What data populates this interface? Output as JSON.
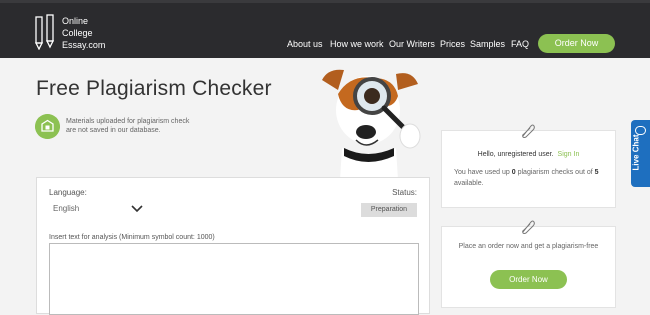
{
  "header": {
    "logo_lines": [
      "Online",
      "College",
      "Essay.com"
    ],
    "nav": [
      "About us",
      "How we work",
      "Our Writers",
      "Prices",
      "Samples",
      "FAQ"
    ],
    "order_button": "Order Now"
  },
  "hero": {
    "title": "Free Plagiarism Checker",
    "note": "Materials uploaded for plagiarism check are not saved in our database."
  },
  "checker": {
    "language_label": "Language:",
    "language_value": "English",
    "status_label": "Status:",
    "status_value": "Preparation",
    "textarea_label": "Insert text for analysis (Minimum symbol count: 1000)"
  },
  "user_card": {
    "hello": "Hello, unregistered user.",
    "sign_in": "Sign In",
    "usage_prefix": "You have used up",
    "used_count": "0",
    "usage_middle": "plagiarism checks out of",
    "total_count": "5",
    "usage_suffix": "available."
  },
  "order_card": {
    "message": "Place an order now and get a plagiarism-free",
    "button": "Order Now"
  },
  "live_chat": {
    "label": "Live Chat"
  },
  "colors": {
    "header_bg": "#2b2b2e",
    "accent_green": "#8cc152",
    "chat_blue": "#1e6fbf"
  },
  "icons": [
    "pencil-logo-icon",
    "shield-icon",
    "chevron-down-icon",
    "paperclip-icon",
    "chat-bubble-icon"
  ]
}
